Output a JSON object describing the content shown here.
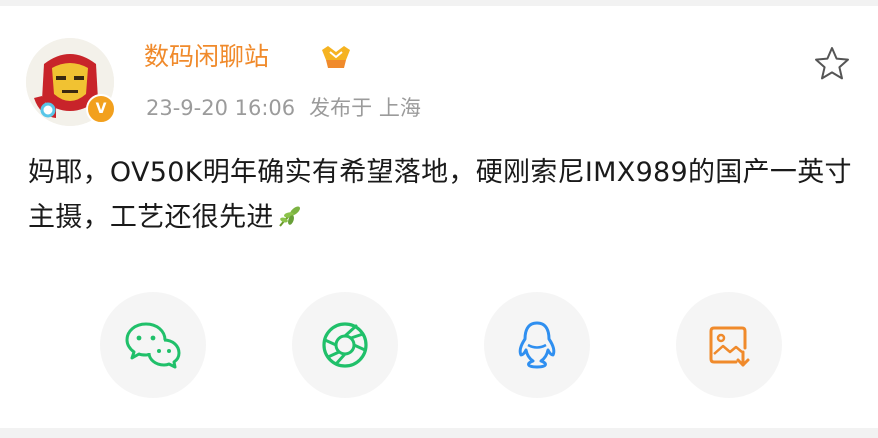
{
  "post": {
    "author": "数码闲聊站",
    "timestamp": "23-9-20 16:06",
    "location": "发布于 上海",
    "text": "妈耶，OV50K明年确实有希望落地，硬刚索尼IMX989的国产一英寸主摄，工艺还很先进",
    "verified_badge": "V"
  },
  "icons": {
    "avatar": "iron-man-avatar",
    "member": "gold-member-badge-icon",
    "favorite": "star-outline-icon",
    "emoji": "leaf-emoji-icon"
  },
  "share": [
    {
      "name": "wechat",
      "icon": "wechat-icon",
      "color": "#20c06a"
    },
    {
      "name": "moments",
      "icon": "aperture-icon",
      "color": "#20c06a"
    },
    {
      "name": "qq",
      "icon": "qq-penguin-icon",
      "color": "#2f8ff0"
    },
    {
      "name": "save-image",
      "icon": "save-image-icon",
      "color": "#f08a2b"
    }
  ],
  "colors": {
    "author": "#f08a2b",
    "meta": "#9b9b9b",
    "text": "#1a1a1a",
    "button_bg": "#f5f5f5"
  }
}
